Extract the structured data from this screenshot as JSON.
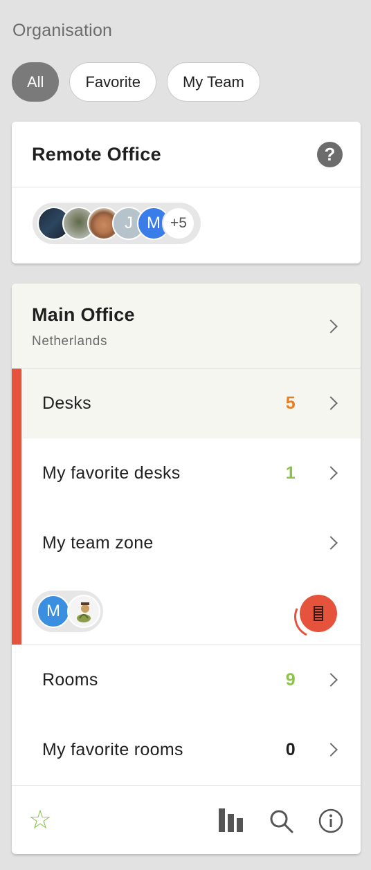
{
  "header": {
    "title": "Organisation"
  },
  "filters": [
    {
      "label": "All",
      "active": true
    },
    {
      "label": "Favorite",
      "active": false
    },
    {
      "label": "My Team",
      "active": false
    }
  ],
  "remote_office": {
    "title": "Remote Office",
    "help_icon": "question-circle-icon",
    "avatars": [
      "photo",
      "photo",
      "photo",
      "J",
      "M"
    ],
    "more_count": "+5"
  },
  "main_office": {
    "title": "Main Office",
    "subtitle": "Netherlands",
    "zone_color": "#e5533d",
    "rows": {
      "desks": {
        "label": "Desks",
        "count": "5",
        "count_color": "#e67e22"
      },
      "favorite_desks": {
        "label": "My favorite desks",
        "count": "1",
        "count_color": "#8bc34a"
      },
      "team_zone": {
        "label": "My team zone"
      },
      "rooms": {
        "label": "Rooms",
        "count": "9",
        "count_color": "#8bc34a"
      },
      "favorite_rooms": {
        "label": "My favorite rooms",
        "count": "0",
        "count_color": "#1f1f1f"
      }
    },
    "team_avatars": [
      "M",
      "sprite"
    ],
    "timer_icon": "desk-timer-icon"
  },
  "footer": {
    "icons": [
      "star-icon",
      "bar-chart-icon",
      "search-icon",
      "info-icon"
    ]
  }
}
